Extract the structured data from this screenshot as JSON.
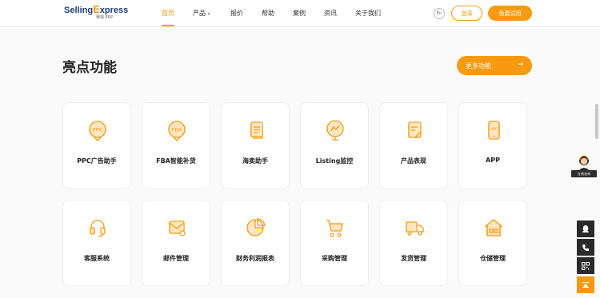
{
  "brand": {
    "name_part1": "Selling",
    "name_e": "E",
    "name_part2": "xpress",
    "tagline": "赛狐 ERP"
  },
  "nav": {
    "items": [
      {
        "label": "首页",
        "active": true
      },
      {
        "label": "产品",
        "has_caret": true
      },
      {
        "label": "报价"
      },
      {
        "label": "帮助"
      },
      {
        "label": "案例"
      },
      {
        "label": "资讯"
      },
      {
        "label": "关于我们"
      }
    ],
    "caret": "∨"
  },
  "header_actions": {
    "lang": "En",
    "login": "登录",
    "trial": "免费试用"
  },
  "section": {
    "title": "亮点功能",
    "more_label": "更多功能",
    "more_arrow": "→"
  },
  "features": [
    {
      "label": "PPC广告助手",
      "icon": "ppc-icon",
      "icon_text": "PPC"
    },
    {
      "label": "FBA智能补货",
      "icon": "fba-icon",
      "icon_text": "FBA"
    },
    {
      "label": "海卖助手",
      "icon": "document-icon"
    },
    {
      "label": "Listing监控",
      "icon": "monitor-icon"
    },
    {
      "label": "产品表现",
      "icon": "report-icon"
    },
    {
      "label": "APP",
      "icon": "phone-icon",
      "icon_text": "APP"
    },
    {
      "label": "客服系统",
      "icon": "headset-icon"
    },
    {
      "label": "邮件管理",
      "icon": "mail-icon"
    },
    {
      "label": "财务利润报表",
      "icon": "pie-chart-icon"
    },
    {
      "label": "采购管理",
      "icon": "cart-icon"
    },
    {
      "label": "发货管理",
      "icon": "truck-icon"
    },
    {
      "label": "仓储管理",
      "icon": "warehouse-icon"
    }
  ],
  "support_widget": {
    "badge": "在线咨询"
  },
  "colors": {
    "accent": "#f59a11",
    "brand_blue": "#1f3b7a",
    "dark": "#2a2a2a"
  }
}
